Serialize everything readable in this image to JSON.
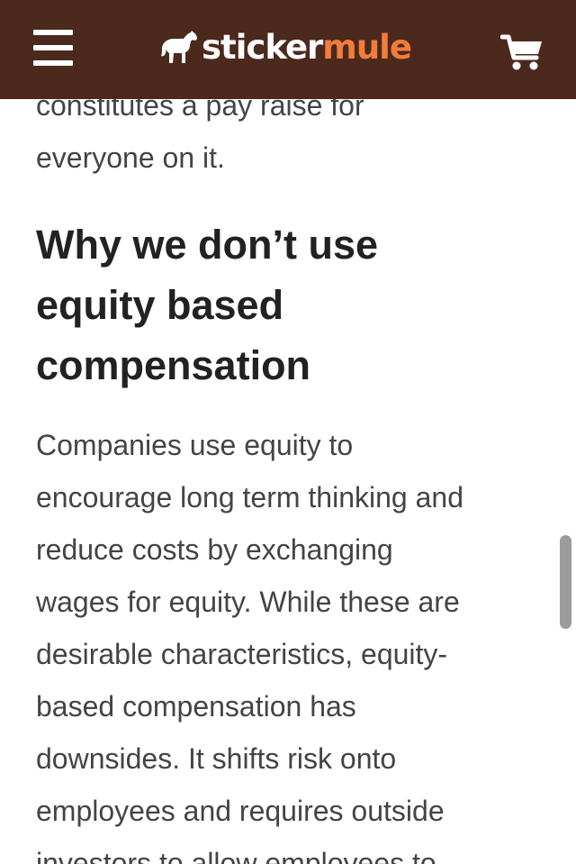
{
  "header": {
    "brand_sticker": "sticker",
    "brand_mule": "mule",
    "colors": {
      "background": "#4b2a1d",
      "logo_accent": "#f47c3c",
      "logo_primary": "#ffffff"
    }
  },
  "article": {
    "previous_paragraph_lines": [
      "constitutes a pay raise for",
      "everyone on it."
    ],
    "heading_lines": [
      "Why we don’t use",
      "equity based",
      "compensation"
    ],
    "paragraph_lines": [
      "Companies use equity to",
      "encourage long term thinking and",
      "reduce costs by exchanging",
      "wages for equity. While these are",
      "desirable characteristics, equity-",
      "based compensation has",
      "downsides. It shifts risk onto",
      "employees and requires outside",
      "investors to allow employees to"
    ]
  },
  "icons": {
    "menu": "hamburger-menu-icon",
    "logo": "horse-logo-icon",
    "cart": "shopping-cart-icon"
  }
}
